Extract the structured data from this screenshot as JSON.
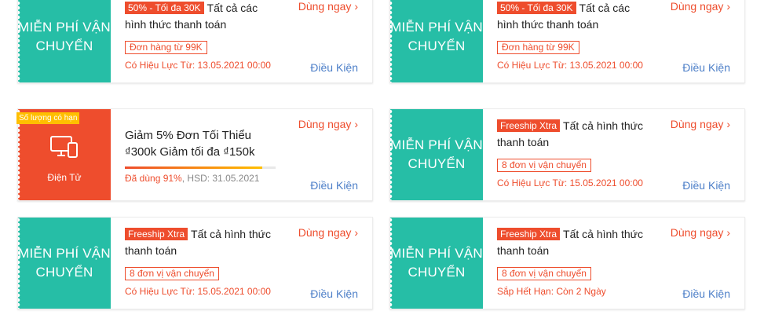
{
  "colors": {
    "teal": "#26bea6",
    "orange": "#ee4d2d",
    "link_blue": "#4d7fc8",
    "yellow": "#ffbf00"
  },
  "common": {
    "use_now": "Dùng ngay",
    "terms": "Điều Kiện",
    "free_ship_title": "MIỄN PHÍ VẬN CHUYỂN"
  },
  "vouchers": [
    {
      "tag": "50% - Tối đa 30K",
      "headline": "Tất cả các hình thức thanh toán",
      "condition": "Đơn hàng từ 99K",
      "validity": "Có Hiệu Lực Từ: 13.05.2021 00:00"
    },
    {
      "tag": "50% - Tối đa 30K",
      "headline": "Tất cả các hình thức thanh toán",
      "condition": "Đơn hàng từ 99K",
      "validity": "Có Hiệu Lực Từ: 13.05.2021 00:00"
    },
    {
      "limited_badge": "Số lượng có hạn",
      "category": "Điện Tử",
      "icon": "computer-devices-icon",
      "title": "Giảm 5% Đơn Tối Thiểu ₫300k Giảm tối đa ₫150k",
      "used_label": "Đã dùng 91%",
      "used_percent": 91,
      "expiry": ", HSD: 31.05.2021"
    },
    {
      "tag": "Freeship Xtra",
      "headline": "Tất cả hình thức thanh toán",
      "condition": "8 đơn vị vận chuyển",
      "validity": "Có Hiệu Lực Từ: 15.05.2021 00:00"
    },
    {
      "tag": "Freeship Xtra",
      "headline": "Tất cả hình thức thanh toán",
      "condition": "8 đơn vị vận chuyển",
      "validity": "Có Hiệu Lực Từ: 15.05.2021 00:00"
    },
    {
      "tag": "Freeship Xtra",
      "headline": "Tất cả hình thức thanh toán",
      "condition": "8 đơn vị vận chuyển",
      "validity": "Sắp Hết Hạn: Còn 2 Ngày"
    }
  ]
}
